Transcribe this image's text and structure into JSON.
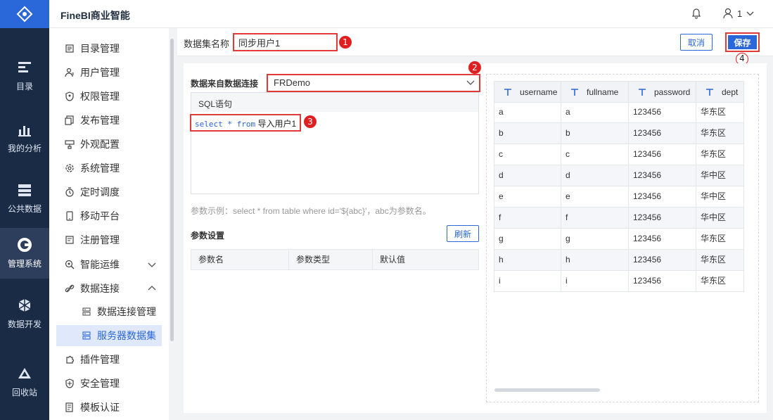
{
  "app": {
    "title": "FineBI商业智能",
    "user": "1"
  },
  "rail": [
    {
      "label": "目录",
      "icon": "catalog-icon"
    },
    {
      "label": "我的分析",
      "icon": "analysis-icon"
    },
    {
      "label": "公共数据",
      "icon": "public-data-icon"
    },
    {
      "label": "管理系统",
      "icon": "management-icon",
      "active": true
    },
    {
      "label": "数据开发",
      "icon": "data-dev-icon"
    },
    {
      "label": "回收站",
      "icon": "recycle-icon"
    }
  ],
  "menu": [
    {
      "label": "目录管理",
      "icon": "directory-icon"
    },
    {
      "label": "用户管理",
      "icon": "user-icon"
    },
    {
      "label": "权限管理",
      "icon": "permission-icon"
    },
    {
      "label": "发布管理",
      "icon": "publish-icon"
    },
    {
      "label": "外观配置",
      "icon": "appearance-icon"
    },
    {
      "label": "系统管理",
      "icon": "system-icon"
    },
    {
      "label": "定时调度",
      "icon": "timer-icon"
    },
    {
      "label": "移动平台",
      "icon": "mobile-icon"
    },
    {
      "label": "注册管理",
      "icon": "register-icon"
    },
    {
      "label": "智能运维",
      "icon": "ops-icon",
      "expandable": "down"
    },
    {
      "label": "数据连接",
      "icon": "link-icon",
      "expandable": "up"
    },
    {
      "label": "数据连接管理",
      "icon": "connection-mgmt-icon",
      "sub": true
    },
    {
      "label": "服务器数据集",
      "icon": "server-dataset-icon",
      "sub": true,
      "selected": true
    },
    {
      "label": "插件管理",
      "icon": "plugin-icon"
    },
    {
      "label": "安全管理",
      "icon": "security-icon"
    },
    {
      "label": "模板认证",
      "icon": "template-icon"
    }
  ],
  "header": {
    "dataset_name_label": "数据集名称",
    "dataset_name_value": "同步用户1",
    "cancel_label": "取消",
    "save_label": "保存"
  },
  "markers": [
    "1",
    "2",
    "3",
    "4"
  ],
  "connection": {
    "label": "数据来自数据连接",
    "value": "FRDemo"
  },
  "sql": {
    "tab_label": "SQL语句",
    "keyword_part": "select * from",
    "table_part": "导入用户1",
    "hint": "参数示例：select * from table where id='${abc}'，abc为参数名。"
  },
  "params": {
    "title": "参数设置",
    "refresh_label": "刷新",
    "columns": [
      "参数名",
      "参数类型",
      "默认值"
    ]
  },
  "preview": {
    "columns": [
      "username",
      "fullname",
      "password",
      "dept"
    ],
    "rows": [
      [
        "a",
        "a",
        "123456",
        "华东区"
      ],
      [
        "b",
        "b",
        "123456",
        "华东区"
      ],
      [
        "c",
        "c",
        "123456",
        "华东区"
      ],
      [
        "d",
        "d",
        "123456",
        "华中区"
      ],
      [
        "e",
        "e",
        "123456",
        "华中区"
      ],
      [
        "f",
        "f",
        "123456",
        "华中区"
      ],
      [
        "g",
        "g",
        "123456",
        "华东区"
      ],
      [
        "h",
        "h",
        "123456",
        "华东区"
      ],
      [
        "i",
        "i",
        "123456",
        "华东区"
      ]
    ]
  },
  "colors": {
    "accent": "#2a67d8",
    "rail_bg": "#1a2b45",
    "highlight": "#e03b3b"
  }
}
